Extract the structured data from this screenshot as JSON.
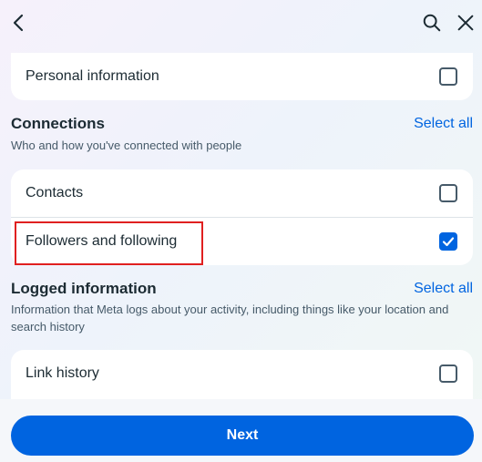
{
  "header": {
    "back_icon": "chevron-left-icon",
    "search_icon": "search-icon",
    "close_icon": "close-icon"
  },
  "personal": {
    "items": [
      {
        "label": "Personal information",
        "checked": false
      }
    ]
  },
  "connections": {
    "title": "Connections",
    "select_all": "Select all",
    "description": "Who and how you've connected with people",
    "items": [
      {
        "label": "Contacts",
        "checked": false
      },
      {
        "label": "Followers and following",
        "checked": true
      }
    ]
  },
  "logged": {
    "title": "Logged information",
    "select_all": "Select all",
    "description": "Information that Meta logs about your activity, including things like your location and search history",
    "items": [
      {
        "label": "Link history",
        "checked": false
      }
    ]
  },
  "footer": {
    "next_label": "Next"
  },
  "colors": {
    "accent": "#0064e0",
    "highlight": "#e02020"
  }
}
